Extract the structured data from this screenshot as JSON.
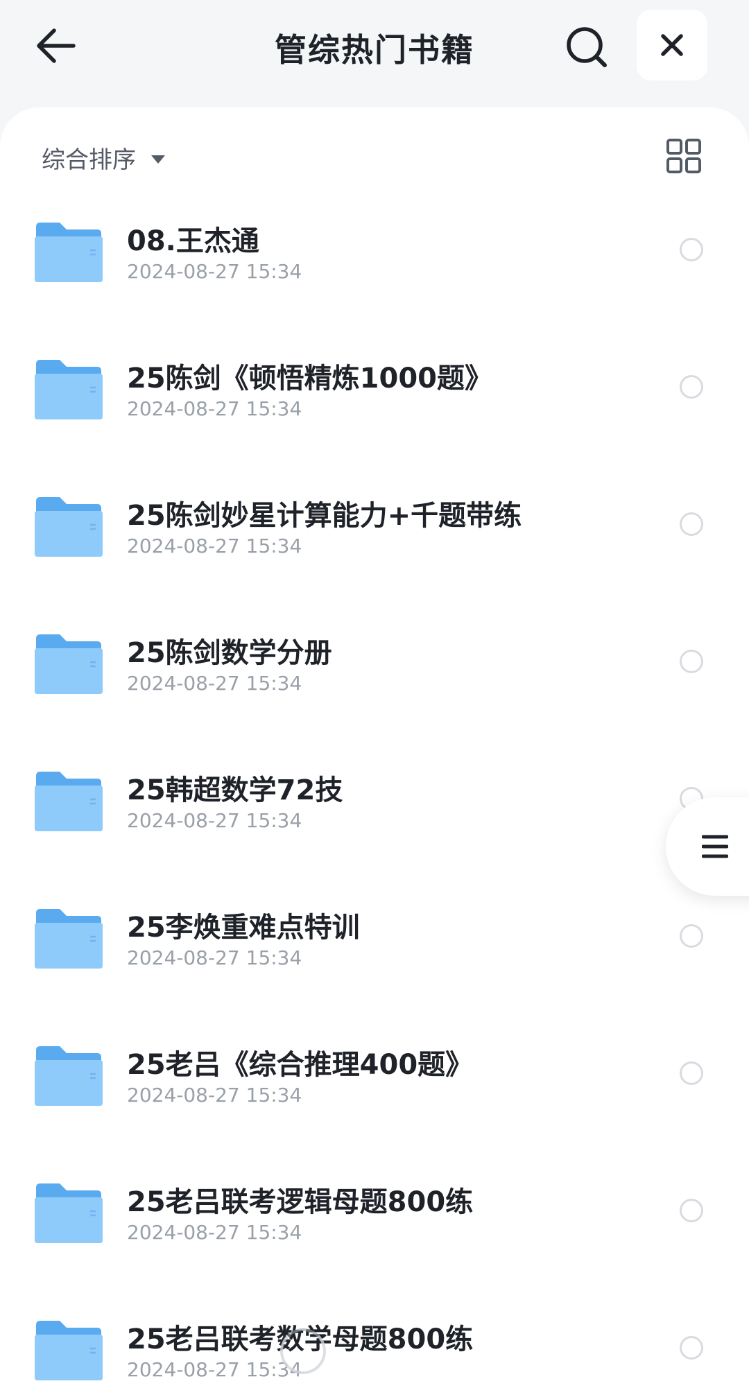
{
  "header": {
    "title": "管综热门书籍",
    "back_icon": "arrow-left-icon",
    "search_icon": "search-icon",
    "close_icon": "close-icon"
  },
  "toolbar": {
    "sort_label": "综合排序",
    "view_toggle_icon": "grid-view-icon"
  },
  "items": [
    {
      "name": "08.王杰通",
      "date": "2024-08-27 15:34"
    },
    {
      "name": "25陈剑《顿悟精炼1000题》",
      "date": "2024-08-27 15:34"
    },
    {
      "name": "25陈剑妙星计算能力+千题带练",
      "date": "2024-08-27 15:34"
    },
    {
      "name": "25陈剑数学分册",
      "date": "2024-08-27 15:34"
    },
    {
      "name": "25韩超数学72技",
      "date": "2024-08-27 15:34"
    },
    {
      "name": "25李焕重难点特训",
      "date": "2024-08-27 15:34"
    },
    {
      "name": "25老吕《综合推理400题》",
      "date": "2024-08-27 15:34"
    },
    {
      "name": "25老吕联考逻辑母题800练",
      "date": "2024-08-27 15:34"
    },
    {
      "name": "25老吕联考数学母题800练",
      "date": "2024-08-27 15:34"
    }
  ],
  "colors": {
    "folder_back": "#5aaaf0",
    "folder_front": "#8fcbfa",
    "text_primary": "#1f2329",
    "text_secondary": "#9aa0a8",
    "background": "#f5f6f8"
  }
}
